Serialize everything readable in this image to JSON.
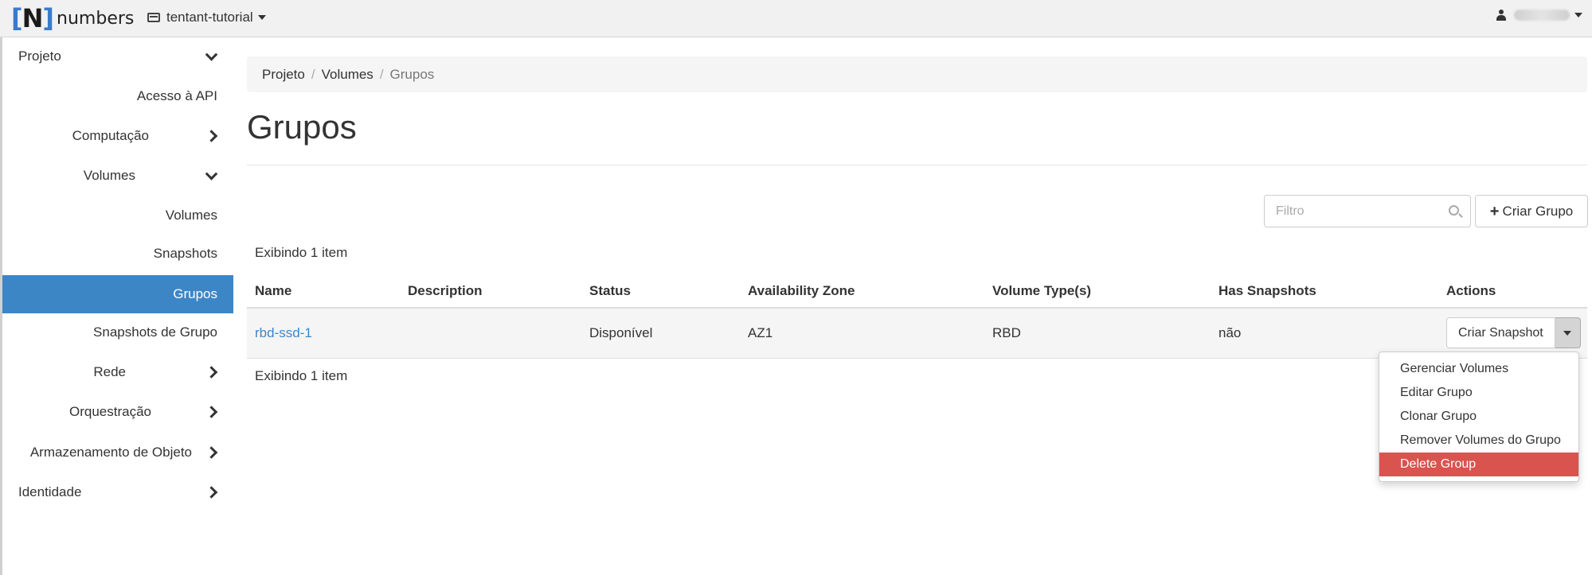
{
  "topbar": {
    "brand_mark_open": "[",
    "brand_mark_letter": "N",
    "brand_mark_close": "]",
    "brand_text": "numbers",
    "project_name": "tentant-tutorial"
  },
  "sidebar": {
    "projeto": "Projeto",
    "acesso_api": "Acesso à API",
    "computacao": "Computação",
    "volumes_group": "Volumes",
    "volumes": "Volumes",
    "snapshots": "Snapshots",
    "grupos": "Grupos",
    "snapshots_de_grupo": "Snapshots de Grupo",
    "rede": "Rede",
    "orquestracao": "Orquestração",
    "armazenamento": "Armazenamento de Objeto",
    "identidade": "Identidade"
  },
  "breadcrumb": {
    "items": [
      "Projeto",
      "Volumes",
      "Grupos"
    ],
    "separator": "/"
  },
  "page": {
    "title": "Grupos"
  },
  "toolbar": {
    "filter_placeholder": "Filtro",
    "create_label": "Criar Grupo"
  },
  "table": {
    "count_top": "Exibindo 1 item",
    "count_bottom": "Exibindo 1 item",
    "headers": [
      "Name",
      "Description",
      "Status",
      "Availability Zone",
      "Volume Type(s)",
      "Has Snapshots",
      "Actions"
    ],
    "rows": [
      {
        "name": "rbd-ssd-1",
        "description": "",
        "status": "Disponível",
        "availability_zone": "AZ1",
        "volume_types": "RBD",
        "has_snapshots": "não",
        "action_label": "Criar Snapshot"
      }
    ]
  },
  "dropdown": {
    "items": [
      "Gerenciar Volumes",
      "Editar Grupo",
      "Clonar Grupo",
      "Remover Volumes do Grupo",
      "Delete Group"
    ]
  },
  "colors": {
    "accent": "#3d86c6",
    "danger": "#d9534f",
    "topbar_bg": "#f1f1f1",
    "breadcrumb_bg": "#f5f5f5"
  }
}
